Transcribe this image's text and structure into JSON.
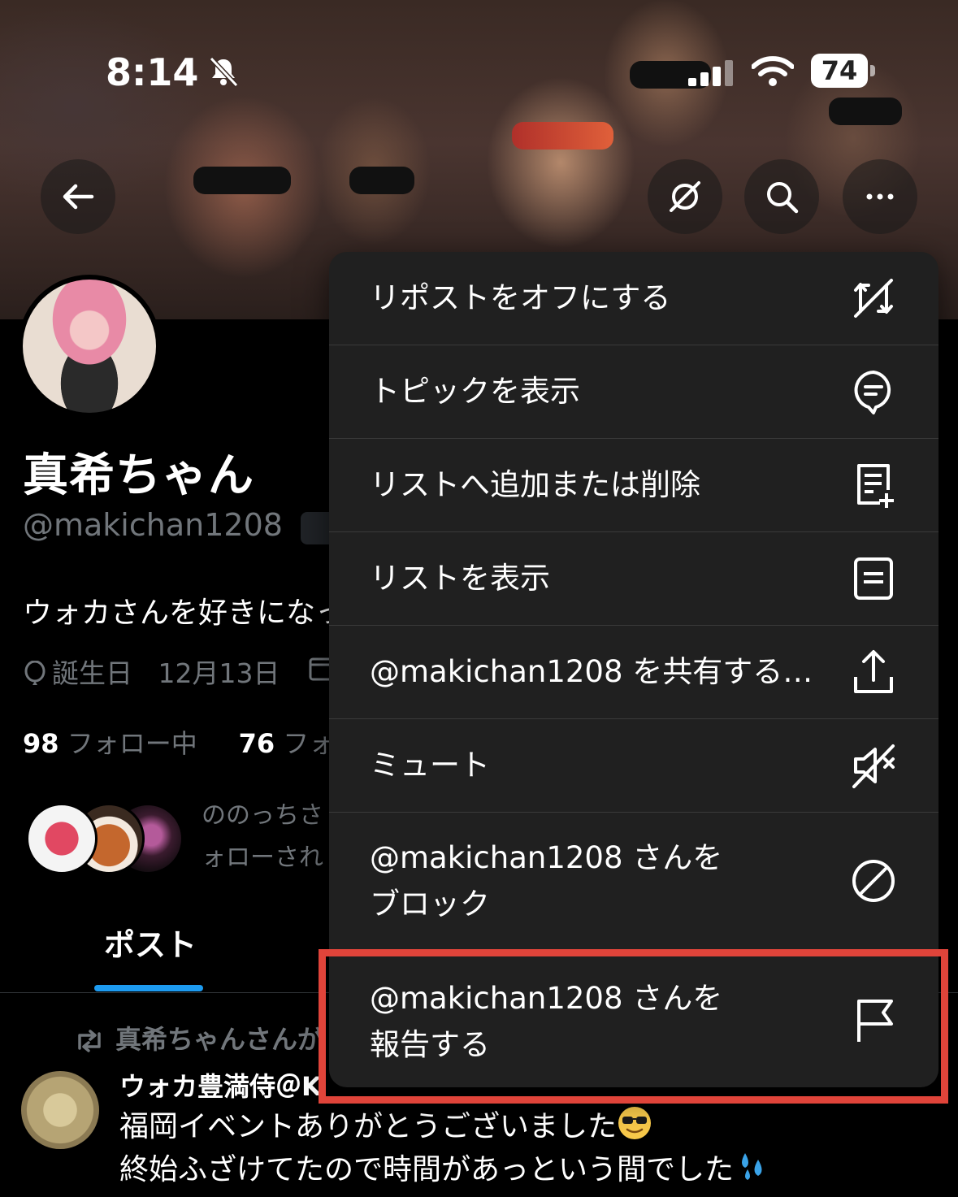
{
  "status_bar": {
    "time": "8:14",
    "battery": "74"
  },
  "nav": {
    "back_icon": "arrow-left-icon",
    "grok_icon": "grok-icon",
    "search_icon": "search-icon",
    "more_icon": "more-horizontal-icon"
  },
  "profile": {
    "display_name": "真希ちゃん",
    "handle": "@makichan1208",
    "bio": "ウォカさんを好きになっ",
    "birthday_label": "誕生日",
    "birthday_value": "12月13日",
    "following_count": "98",
    "following_label": "フォロー中",
    "followers_count": "76",
    "followers_label": "フォロ",
    "known_followers_line1": "ののっちさ",
    "known_followers_line2": "ォローされ"
  },
  "tabs": [
    {
      "label": "ポスト",
      "active": true
    }
  ],
  "timeline": {
    "repost_label": "真希ちゃんさんが",
    "tweet_author": "ウォカ豊満侍＠K",
    "tweet_line1": "福岡イベントありがとうございました",
    "tweet_line2": "終始ふざけてたので時間があっという間でした"
  },
  "menu": {
    "items": [
      {
        "label": "リポストをオフにする",
        "icon": "repost-off-icon"
      },
      {
        "label": "トピックを表示",
        "icon": "topic-icon"
      },
      {
        "label": "リストへ追加または削除",
        "icon": "list-add-icon"
      },
      {
        "label": "リストを表示",
        "icon": "list-icon"
      },
      {
        "label": "@makichan1208 を共有する…",
        "icon": "share-icon"
      },
      {
        "label": "ミュート",
        "icon": "mute-icon"
      },
      {
        "label_line1": "@makichan1208 さんを",
        "label_line2": "ブロック",
        "icon": "block-icon"
      },
      {
        "label_line1": "@makichan1208 さんを",
        "label_line2": "報告する",
        "icon": "flag-icon"
      }
    ]
  },
  "colors": {
    "accent": "#1d9bf0",
    "highlight_box": "#e0443a",
    "menu_bg": "#202020"
  }
}
